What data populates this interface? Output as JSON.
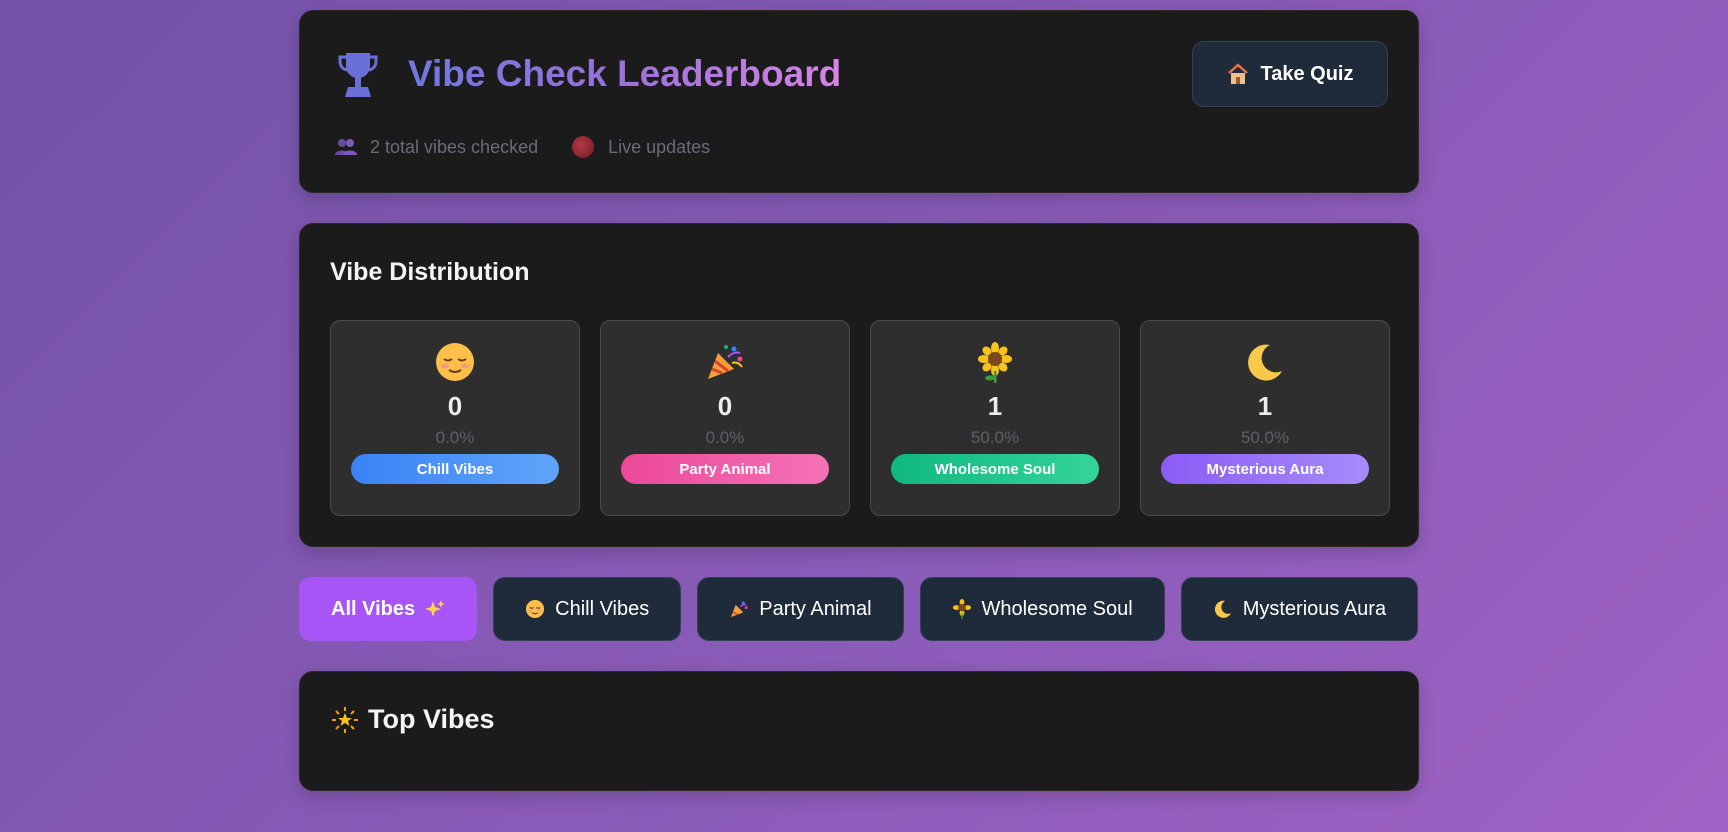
{
  "header": {
    "title": "Vibe Check Leaderboard",
    "total_text": "2 total vibes checked",
    "live_text": "Live updates",
    "quiz_button": "Take Quiz",
    "icons": {
      "title": "trophy-icon",
      "total": "people-icon",
      "live": "live-dot-icon",
      "quiz": "house-icon"
    }
  },
  "distribution": {
    "title": "Vibe Distribution",
    "items": [
      {
        "icon": "relieved-face-icon",
        "count": "0",
        "percent": "0.0%",
        "label": "Chill Vibes",
        "colors": [
          "#3b82f6",
          "#60a5fa"
        ]
      },
      {
        "icon": "party-popper-icon",
        "count": "0",
        "percent": "0.0%",
        "label": "Party Animal",
        "colors": [
          "#ec4899",
          "#f472b6"
        ]
      },
      {
        "icon": "sunflower-icon",
        "count": "1",
        "percent": "50.0%",
        "label": "Wholesome Soul",
        "colors": [
          "#10b981",
          "#34d399"
        ]
      },
      {
        "icon": "crescent-moon-icon",
        "count": "1",
        "percent": "50.0%",
        "label": "Mysterious Aura",
        "colors": [
          "#8b5cf6",
          "#a78bfa"
        ]
      }
    ]
  },
  "filters": {
    "active_index": 0,
    "items": [
      {
        "label": "All Vibes",
        "icon": "sparkles-icon"
      },
      {
        "label": "Chill Vibes",
        "icon": "relieved-face-icon"
      },
      {
        "label": "Party Animal",
        "icon": "party-popper-icon"
      },
      {
        "label": "Wholesome Soul",
        "icon": "sunflower-icon"
      },
      {
        "label": "Mysterious Aura",
        "icon": "crescent-moon-icon"
      }
    ]
  },
  "top_vibes": {
    "title": "Top Vibes",
    "icon": "glowing-star-icon"
  },
  "colors": {
    "accent": "#a855f7",
    "card_bg": "#1b1b1b",
    "chip_bg": "#1f2a3a"
  }
}
